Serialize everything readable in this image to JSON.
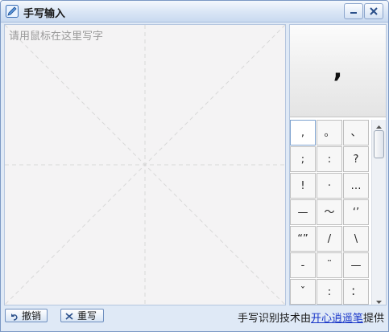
{
  "window": {
    "title": "手写输入"
  },
  "canvas": {
    "placeholder": "请用鼠标在这里写字"
  },
  "preview": {
    "char": ","
  },
  "candidates": [
    ",",
    "。",
    "、",
    ";",
    ":",
    "?",
    "!",
    "·",
    "…",
    "—",
    "～",
    "‘’",
    "“”",
    "/",
    "\\",
    "-",
    "¨",
    "—",
    "ˇ",
    ":",
    "："
  ],
  "buttons": {
    "undo": "撤销",
    "rewrite": "重写"
  },
  "credit": {
    "prefix": "手写识别技术由",
    "link": "开心逍遥笔",
    "suffix": "提供"
  },
  "colors": {
    "accent": "#7b98c4",
    "link": "#1a37c8"
  }
}
